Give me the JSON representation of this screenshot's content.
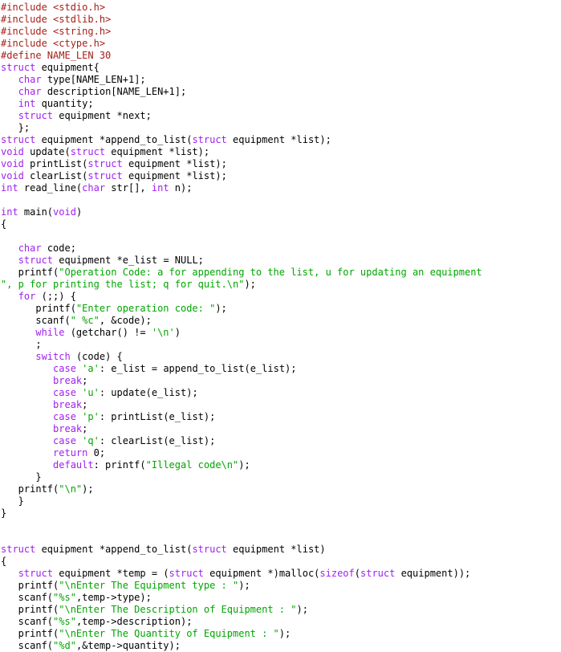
{
  "document": {
    "type": "source-code-listing",
    "language": "C",
    "background_color": "#ffffff",
    "font_size_px": 12,
    "line_height_px": 15,
    "indent_spaces": 3
  },
  "syntax_colors": {
    "plain": "#000000",
    "preprocessor": "#A52019",
    "keyword": "#A020F0",
    "string": "#00A600"
  },
  "lines": [
    [
      {
        "t": "pre",
        "s": "#include <stdio.h>"
      }
    ],
    [
      {
        "t": "pre",
        "s": "#include <stdlib.h>"
      }
    ],
    [
      {
        "t": "pre",
        "s": "#include <string.h>"
      }
    ],
    [
      {
        "t": "pre",
        "s": "#include <ctype.h>"
      }
    ],
    [
      {
        "t": "pre",
        "s": "#define NAME_LEN 30"
      }
    ],
    [
      {
        "t": "kw",
        "s": "struct"
      },
      {
        "t": "plain",
        "s": " equipment{"
      }
    ],
    [
      {
        "t": "plain",
        "s": "   "
      },
      {
        "t": "kw",
        "s": "char"
      },
      {
        "t": "plain",
        "s": " type[NAME_LEN+1];"
      }
    ],
    [
      {
        "t": "plain",
        "s": "   "
      },
      {
        "t": "kw",
        "s": "char"
      },
      {
        "t": "plain",
        "s": " description[NAME_LEN+1];"
      }
    ],
    [
      {
        "t": "plain",
        "s": "   "
      },
      {
        "t": "kw",
        "s": "int"
      },
      {
        "t": "plain",
        "s": " quantity;"
      }
    ],
    [
      {
        "t": "plain",
        "s": "   "
      },
      {
        "t": "kw",
        "s": "struct"
      },
      {
        "t": "plain",
        "s": " equipment *next;"
      }
    ],
    [
      {
        "t": "plain",
        "s": "   };"
      }
    ],
    [
      {
        "t": "kw",
        "s": "struct"
      },
      {
        "t": "plain",
        "s": " equipment *append_to_list("
      },
      {
        "t": "kw",
        "s": "struct"
      },
      {
        "t": "plain",
        "s": " equipment *list);"
      }
    ],
    [
      {
        "t": "kw",
        "s": "void"
      },
      {
        "t": "plain",
        "s": " update("
      },
      {
        "t": "kw",
        "s": "struct"
      },
      {
        "t": "plain",
        "s": " equipment *list);"
      }
    ],
    [
      {
        "t": "kw",
        "s": "void"
      },
      {
        "t": "plain",
        "s": " printList("
      },
      {
        "t": "kw",
        "s": "struct"
      },
      {
        "t": "plain",
        "s": " equipment *list);"
      }
    ],
    [
      {
        "t": "kw",
        "s": "void"
      },
      {
        "t": "plain",
        "s": " clearList("
      },
      {
        "t": "kw",
        "s": "struct"
      },
      {
        "t": "plain",
        "s": " equipment *list);"
      }
    ],
    [
      {
        "t": "kw",
        "s": "int"
      },
      {
        "t": "plain",
        "s": " read_line("
      },
      {
        "t": "kw",
        "s": "char"
      },
      {
        "t": "plain",
        "s": " str[], "
      },
      {
        "t": "kw",
        "s": "int"
      },
      {
        "t": "plain",
        "s": " n);"
      }
    ],
    [],
    [
      {
        "t": "kw",
        "s": "int"
      },
      {
        "t": "plain",
        "s": " main("
      },
      {
        "t": "kw",
        "s": "void"
      },
      {
        "t": "plain",
        "s": ")"
      }
    ],
    [
      {
        "t": "plain",
        "s": "{"
      }
    ],
    [],
    [
      {
        "t": "plain",
        "s": "   "
      },
      {
        "t": "kw",
        "s": "char"
      },
      {
        "t": "plain",
        "s": " code;"
      }
    ],
    [
      {
        "t": "plain",
        "s": "   "
      },
      {
        "t": "kw",
        "s": "struct"
      },
      {
        "t": "plain",
        "s": " equipment *e_list = NULL;"
      }
    ],
    [
      {
        "t": "plain",
        "s": "   printf("
      },
      {
        "t": "str",
        "s": "\"Operation Code: a for appending to the list, u for updating an equipment"
      }
    ],
    [
      {
        "t": "str",
        "s": "\", p for printing the list; q for quit.\\n\""
      },
      {
        "t": "plain",
        "s": ");"
      }
    ],
    [
      {
        "t": "plain",
        "s": "   "
      },
      {
        "t": "kw",
        "s": "for"
      },
      {
        "t": "plain",
        "s": " (;;) {"
      }
    ],
    [
      {
        "t": "plain",
        "s": "      printf("
      },
      {
        "t": "str",
        "s": "\"Enter operation code: \""
      },
      {
        "t": "plain",
        "s": ");"
      }
    ],
    [
      {
        "t": "plain",
        "s": "      scanf("
      },
      {
        "t": "str",
        "s": "\" %c\""
      },
      {
        "t": "plain",
        "s": ", &code);"
      }
    ],
    [
      {
        "t": "plain",
        "s": "      "
      },
      {
        "t": "kw",
        "s": "while"
      },
      {
        "t": "plain",
        "s": " (getchar() != "
      },
      {
        "t": "str",
        "s": "'\\n'"
      },
      {
        "t": "plain",
        "s": ")"
      }
    ],
    [
      {
        "t": "plain",
        "s": "      ;"
      }
    ],
    [
      {
        "t": "plain",
        "s": "      "
      },
      {
        "t": "kw",
        "s": "switch"
      },
      {
        "t": "plain",
        "s": " (code) {"
      }
    ],
    [
      {
        "t": "plain",
        "s": "         "
      },
      {
        "t": "kw",
        "s": "case"
      },
      {
        "t": "plain",
        "s": " "
      },
      {
        "t": "str",
        "s": "'a'"
      },
      {
        "t": "plain",
        "s": ": e_list = append_to_list(e_list);"
      }
    ],
    [
      {
        "t": "plain",
        "s": "         "
      },
      {
        "t": "kw",
        "s": "break"
      },
      {
        "t": "plain",
        "s": ";"
      }
    ],
    [
      {
        "t": "plain",
        "s": "         "
      },
      {
        "t": "kw",
        "s": "case"
      },
      {
        "t": "plain",
        "s": " "
      },
      {
        "t": "str",
        "s": "'u'"
      },
      {
        "t": "plain",
        "s": ": update(e_list);"
      }
    ],
    [
      {
        "t": "plain",
        "s": "         "
      },
      {
        "t": "kw",
        "s": "break"
      },
      {
        "t": "plain",
        "s": ";"
      }
    ],
    [
      {
        "t": "plain",
        "s": "         "
      },
      {
        "t": "kw",
        "s": "case"
      },
      {
        "t": "plain",
        "s": " "
      },
      {
        "t": "str",
        "s": "'p'"
      },
      {
        "t": "plain",
        "s": ": printList(e_list);"
      }
    ],
    [
      {
        "t": "plain",
        "s": "         "
      },
      {
        "t": "kw",
        "s": "break"
      },
      {
        "t": "plain",
        "s": ";"
      }
    ],
    [
      {
        "t": "plain",
        "s": "         "
      },
      {
        "t": "kw",
        "s": "case"
      },
      {
        "t": "plain",
        "s": " "
      },
      {
        "t": "str",
        "s": "'q'"
      },
      {
        "t": "plain",
        "s": ": clearList(e_list);"
      }
    ],
    [
      {
        "t": "plain",
        "s": "         "
      },
      {
        "t": "kw",
        "s": "return"
      },
      {
        "t": "plain",
        "s": " 0;"
      }
    ],
    [
      {
        "t": "plain",
        "s": "         "
      },
      {
        "t": "kw",
        "s": "default"
      },
      {
        "t": "plain",
        "s": ": printf("
      },
      {
        "t": "str",
        "s": "\"Illegal code\\n\""
      },
      {
        "t": "plain",
        "s": ");"
      }
    ],
    [
      {
        "t": "plain",
        "s": "      }"
      }
    ],
    [
      {
        "t": "plain",
        "s": "   printf("
      },
      {
        "t": "str",
        "s": "\"\\n\""
      },
      {
        "t": "plain",
        "s": ");"
      }
    ],
    [
      {
        "t": "plain",
        "s": "   }"
      }
    ],
    [
      {
        "t": "plain",
        "s": "}"
      }
    ],
    [],
    [],
    [
      {
        "t": "kw",
        "s": "struct"
      },
      {
        "t": "plain",
        "s": " equipment *append_to_list("
      },
      {
        "t": "kw",
        "s": "struct"
      },
      {
        "t": "plain",
        "s": " equipment *list)"
      }
    ],
    [
      {
        "t": "plain",
        "s": "{"
      }
    ],
    [
      {
        "t": "plain",
        "s": "   "
      },
      {
        "t": "kw",
        "s": "struct"
      },
      {
        "t": "plain",
        "s": " equipment *temp = ("
      },
      {
        "t": "kw",
        "s": "struct"
      },
      {
        "t": "plain",
        "s": " equipment *)malloc("
      },
      {
        "t": "kw",
        "s": "sizeof"
      },
      {
        "t": "plain",
        "s": "("
      },
      {
        "t": "kw",
        "s": "struct"
      },
      {
        "t": "plain",
        "s": " equipment));"
      }
    ],
    [
      {
        "t": "plain",
        "s": "   printf("
      },
      {
        "t": "str",
        "s": "\"\\nEnter The Equipment type : \""
      },
      {
        "t": "plain",
        "s": ");"
      }
    ],
    [
      {
        "t": "plain",
        "s": "   scanf("
      },
      {
        "t": "str",
        "s": "\"%s\""
      },
      {
        "t": "plain",
        "s": ",temp->type);"
      }
    ],
    [
      {
        "t": "plain",
        "s": "   printf("
      },
      {
        "t": "str",
        "s": "\"\\nEnter The Description of Equipment : \""
      },
      {
        "t": "plain",
        "s": ");"
      }
    ],
    [
      {
        "t": "plain",
        "s": "   scanf("
      },
      {
        "t": "str",
        "s": "\"%s\""
      },
      {
        "t": "plain",
        "s": ",temp->description);"
      }
    ],
    [
      {
        "t": "plain",
        "s": "   printf("
      },
      {
        "t": "str",
        "s": "\"\\nEnter The Quantity of Equipment : \""
      },
      {
        "t": "plain",
        "s": ");"
      }
    ],
    [
      {
        "t": "plain",
        "s": "   scanf("
      },
      {
        "t": "str",
        "s": "\"%d\""
      },
      {
        "t": "plain",
        "s": ",&temp->quantity);"
      }
    ]
  ]
}
